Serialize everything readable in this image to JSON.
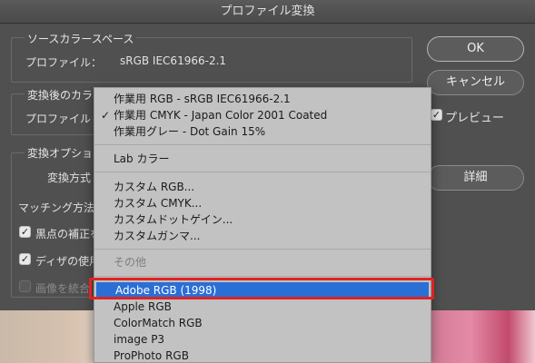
{
  "window": {
    "title": "プロファイル変換"
  },
  "source": {
    "title": "ソースカラースペース",
    "profile_label": "プロファイル：",
    "profile_value": "sRGB IEC61966-2.1"
  },
  "dest": {
    "title": "変換後のカラー",
    "profile_label": "プロファイル"
  },
  "options": {
    "title": "変換オプション",
    "method_label": "変換方式",
    "matching_label": "マッチング方法",
    "black_point_label": "黒点の補正を",
    "dither_label": "ディザの使用",
    "flatten_label": "画像を統合"
  },
  "buttons": {
    "ok": "OK",
    "cancel": "キャンセル",
    "preview": "プレビュー",
    "details": "詳細"
  },
  "menu": {
    "items_top": [
      {
        "label": "作業用 RGB - sRGB IEC61966-2.1",
        "checked": false
      },
      {
        "label": "作業用 CMYK - Japan Color 2001 Coated",
        "checked": true
      },
      {
        "label": "作業用グレー - Dot Gain 15%",
        "checked": false
      }
    ],
    "lab": "Lab カラー",
    "custom": [
      "カスタム RGB...",
      "カスタム CMYK...",
      "カスタムドットゲイン...",
      "カスタムガンマ..."
    ],
    "other_header": "その他",
    "others": [
      "Adobe RGB (1998)",
      "Apple RGB",
      "ColorMatch RGB",
      "image P3",
      "ProPhoto RGB"
    ],
    "selected": "Adobe RGB (1998)",
    "check_mark": "✓"
  }
}
